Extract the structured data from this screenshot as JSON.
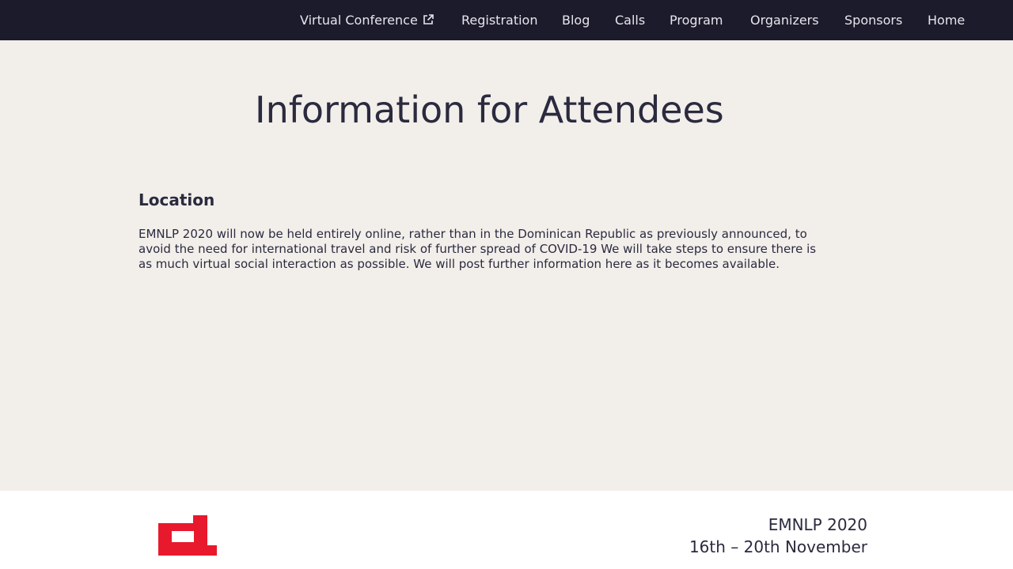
{
  "nav": {
    "items": [
      {
        "label": "Virtual Conference",
        "external": true
      },
      {
        "label": "Registration"
      },
      {
        "label": "Blog"
      },
      {
        "label": "Calls"
      },
      {
        "label": "Program"
      },
      {
        "label": "Organizers"
      },
      {
        "label": "Sponsors"
      },
      {
        "label": "Home"
      }
    ]
  },
  "page": {
    "title": "Information for Attendees",
    "section_heading": "Location",
    "paragraph_lines": [
      "EMNLP 2020 will now be held entirely online, rather than in the Dominican Republic as previously announced, to",
      "avoid the need for international travel and risk of further spread of COVID-19 We will take steps to ensure there is",
      "as much virtual social interaction as possible. We will post further information here as it becomes available."
    ]
  },
  "footer": {
    "name": "EMNLP 2020",
    "dates": "16th – 20th November",
    "logo_color": "#e8192c"
  },
  "icons": {
    "external": "external-link-icon"
  },
  "colors": {
    "nav_bg": "#1c1b2b",
    "page_bg": "#f2efeb",
    "text": "#2b2a3e"
  }
}
